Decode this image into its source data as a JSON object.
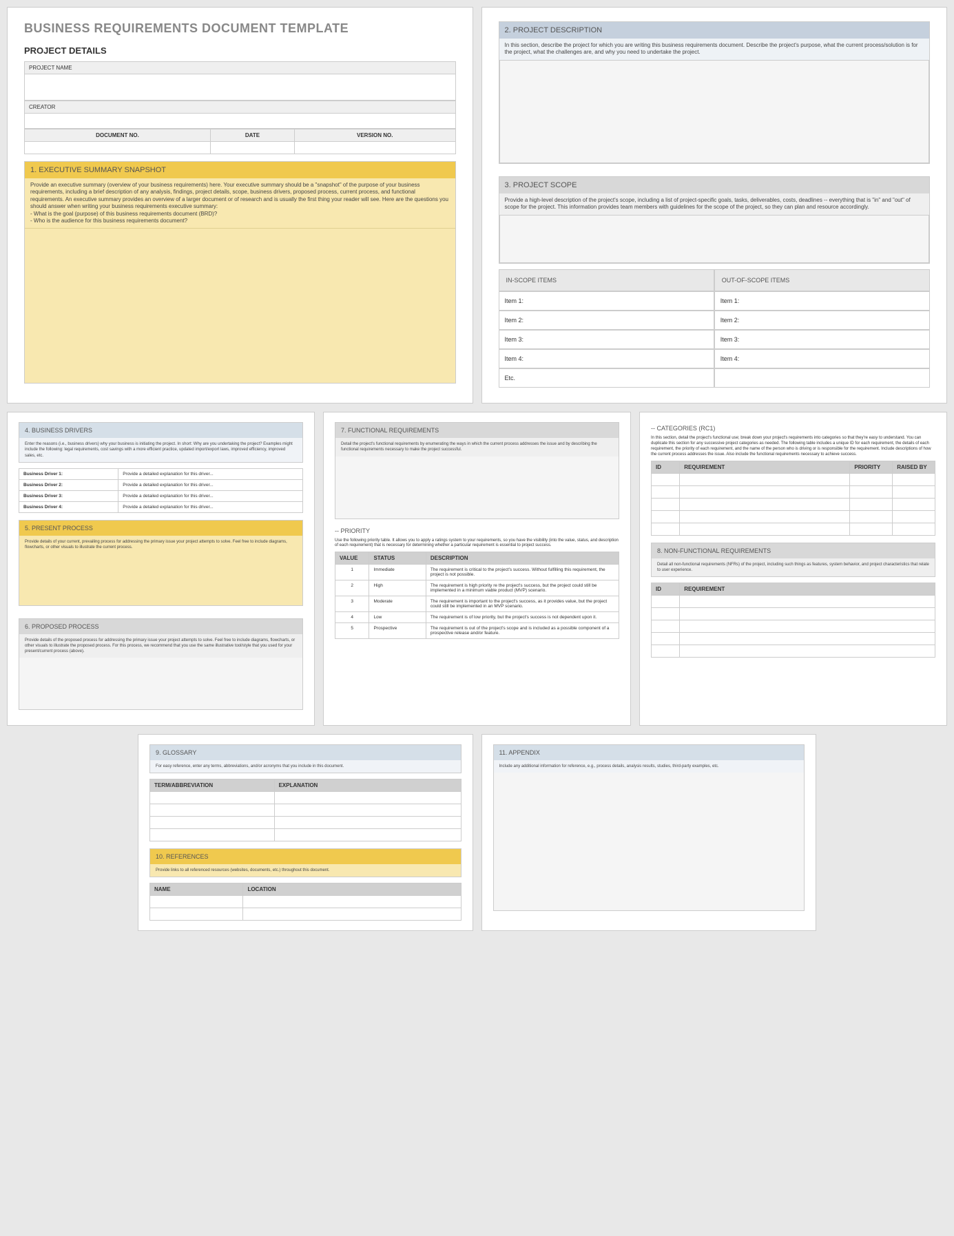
{
  "title": "BUSINESS REQUIREMENTS DOCUMENT TEMPLATE",
  "projectDetails": {
    "heading": "PROJECT DETAILS",
    "projectName": "PROJECT NAME",
    "creator": "CREATOR",
    "docNo": "DOCUMENT NO.",
    "date": "DATE",
    "versionNo": "VERSION NO."
  },
  "sec1": {
    "title": "1. EXECUTIVE SUMMARY SNAPSHOT",
    "body": "Provide an executive summary (overview of your business requirements) here. Your executive summary should be a \"snapshot\" of the purpose of your business requirements, including a brief description of any analysis, findings, project details, scope, business drivers, proposed process, current process, and functional requirements. An executive summary provides an overview of a larger document or of research and is usually the first thing your reader will see. Here are the questions you should answer when writing your business requirements executive summary:",
    "q1": "- What is the goal (purpose) of this business requirements document (BRD)?",
    "q2": "- Who is the audience for this business requirements document?"
  },
  "sec2": {
    "title": "2. PROJECT DESCRIPTION",
    "body": "In this section, describe the project for which you are writing this business requirements document. Describe the project's purpose, what the current process/solution is for the project, what the challenges are, and why you need to undertake the project."
  },
  "sec3": {
    "title": "3. PROJECT SCOPE",
    "body": "Provide a high-level description of the project's scope, including a list of project-specific goals, tasks, deliverables, costs, deadlines -- everything that is \"in\" and \"out\" of scope for the project. This information provides team members with guidelines for the scope of the project, so they can plan and resource accordingly.",
    "inScope": "IN-SCOPE ITEMS",
    "outScope": "OUT-OF-SCOPE ITEMS",
    "items": [
      "Item 1:",
      "Item 2:",
      "Item 3:",
      "Item 4:",
      "Etc."
    ]
  },
  "sec4": {
    "title": "4. BUSINESS DRIVERS",
    "body": "Enter the reasons (i.e., business drivers) why your business is initiating the project. In short: Why are you undertaking the project? Examples might include the following: legal requirements, cost savings with a more efficient practice, updated import/export laws, improved efficiency, improved sales, etc.",
    "rows": [
      {
        "label": "Business Driver 1:",
        "val": "Provide a detailed explanation for this driver..."
      },
      {
        "label": "Business Driver 2:",
        "val": "Provide a detailed explanation for this driver..."
      },
      {
        "label": "Business Driver 3:",
        "val": "Provide a detailed explanation for this driver..."
      },
      {
        "label": "Business Driver 4:",
        "val": "Provide a detailed explanation for this driver..."
      }
    ]
  },
  "sec5": {
    "title": "5. PRESENT PROCESS",
    "body": "Provide details of your current, prevailing process for addressing the primary issue your project attempts to solve. Feel free to include diagrams, flowcharts, or other visuals to illustrate the current process."
  },
  "sec6": {
    "title": "6. PROPOSED PROCESS",
    "body": "Provide details of the proposed process for addressing the primary issue your project attempts to solve. Feel free to include diagrams, flowcharts, or other visuals to illustrate the proposed process. For this process, we recommend that you use the same illustrative tool/style that you used for your present/current process (above)."
  },
  "sec7": {
    "title": "7. FUNCTIONAL REQUIREMENTS",
    "body": "Detail the project's functional requirements by enumerating the ways in which the current process addresses the issue and by describing the functional requirements necessary to make the project successful."
  },
  "priority": {
    "title": "-- PRIORITY",
    "body": "Use the following priority table. It allows you to apply a ratings system to your requirements, so you have the visibility (into the value, status, and description of each requirement) that is necessary for determining whether a particular requirement is essential to project success.",
    "headers": [
      "VALUE",
      "STATUS",
      "DESCRIPTION"
    ],
    "rows": [
      {
        "v": "1",
        "s": "Immediate",
        "d": "The requirement is critical to the project's success. Without fulfilling this requirement, the project is not possible."
      },
      {
        "v": "2",
        "s": "High",
        "d": "The requirement is high priority re the project's success, but the project could still be implemented in a minimum viable product (MVP) scenario."
      },
      {
        "v": "3",
        "s": "Moderate",
        "d": "The requirement is important to the project's success, as it provides value, but the project could still be implemented in an MVP scenario."
      },
      {
        "v": "4",
        "s": "Low",
        "d": "The requirement is of low priority, but the project's success is not dependent upon it."
      },
      {
        "v": "5",
        "s": "Prospective",
        "d": "The requirement is out of the project's scope and is included as a possible component of a prospective release and/or feature."
      }
    ]
  },
  "cat": {
    "title": "-- CATEGORIES (RC1)",
    "body": "In this section, detail the project's functional use; break down your project's requirements into categories so that they're easy to understand. You can duplicate this section for any successive project categories as needed. The following table includes a unique ID for each requirement, the details of each requirement, the priority of each requirement, and the name of the person who is driving or is responsible for the requirement. Include descriptions of how the current process addresses the issue. Also include the functional requirements necessary to achieve success.",
    "headers": [
      "ID",
      "REQUIREMENT",
      "PRIORITY",
      "RAISED BY"
    ]
  },
  "sec8": {
    "title": "8. NON-FUNCTIONAL REQUIREMENTS",
    "body": "Detail all non-functional requirements (NFRs) of the project, including such things as features, system behavior, and project characteristics that relate to user experience.",
    "headers": [
      "ID",
      "REQUIREMENT"
    ]
  },
  "sec9": {
    "title": "9. GLOSSARY",
    "body": "For easy reference, enter any terms, abbreviations, and/or acronyms that you include in this document.",
    "headers": [
      "TERM/ABBREVIATION",
      "EXPLANATION"
    ]
  },
  "sec10": {
    "title": "10. REFERENCES",
    "body": "Provide links to all referenced resources (websites, documents, etc.) throughout this document.",
    "headers": [
      "NAME",
      "LOCATION"
    ]
  },
  "sec11": {
    "title": "11. APPENDIX",
    "body": "Include any additional information for reference, e.g., process details, analysis results, studies, third-party examples, etc."
  }
}
